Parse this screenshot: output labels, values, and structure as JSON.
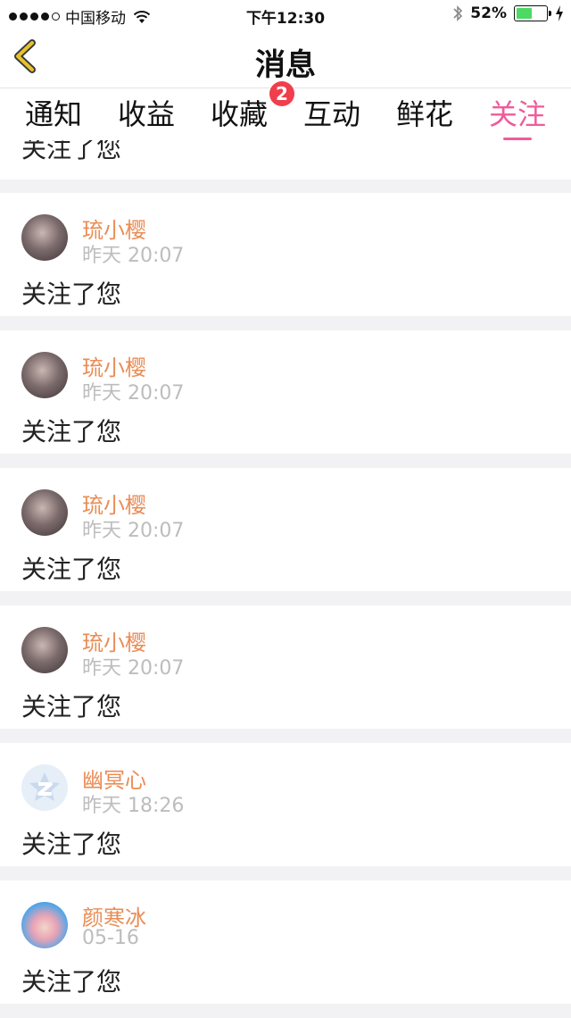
{
  "status_bar": {
    "carrier": "中国移动",
    "time": "下午12:30",
    "battery": "52%",
    "battery_level": 0.52,
    "battery_color": "#4cd964"
  },
  "nav": {
    "title": "消息",
    "back_icon": "chevron-left-icon",
    "back_icon_color": "#e6c22d"
  },
  "tabs": [
    {
      "label": "通知",
      "active": false
    },
    {
      "label": "收益",
      "active": false
    },
    {
      "label": "收藏",
      "active": false,
      "badge": "2"
    },
    {
      "label": "互动",
      "active": false
    },
    {
      "label": "鲜花",
      "active": false
    },
    {
      "label": "关注",
      "active": true
    }
  ],
  "accent_color": "#f05b9a",
  "partial_item": {
    "message": "关注了您"
  },
  "items": [
    {
      "name": "琉小樱",
      "time": "昨天 20:07",
      "message": "关注了您",
      "avatar": "photo"
    },
    {
      "name": "琉小樱",
      "time": "昨天 20:07",
      "message": "关注了您",
      "avatar": "photo"
    },
    {
      "name": "琉小樱",
      "time": "昨天 20:07",
      "message": "关注了您",
      "avatar": "photo"
    },
    {
      "name": "琉小樱",
      "time": "昨天 20:07",
      "message": "关注了您",
      "avatar": "photo"
    },
    {
      "name": "幽冥心",
      "time": "昨天 18:26",
      "message": "关注了您",
      "avatar": "qq"
    },
    {
      "name": "颜寒冰",
      "time": "05-16",
      "message": "关注了您",
      "avatar": "anime"
    }
  ]
}
